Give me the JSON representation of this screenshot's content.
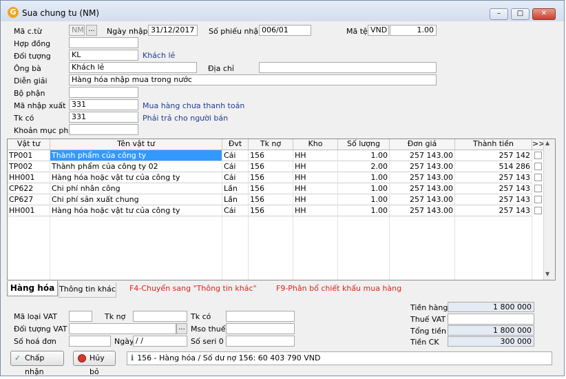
{
  "window": {
    "title": "Sua chung tu (NM)",
    "app_icon": "G",
    "controls": {
      "minimize": "–",
      "maximize": "□",
      "close": "✕"
    }
  },
  "header": {
    "ma_ct": {
      "label": "Mã c.từ",
      "value": "NM",
      "lookup": "..."
    },
    "ngay_nhap": {
      "label": "Ngày nhập",
      "value": "31/12/2017"
    },
    "so_phieu_nhap": {
      "label": "Số phiếu nhập",
      "value": "006/01"
    },
    "ma_te": {
      "label": "Mã tệ",
      "currency": "VND",
      "rate": "1.00"
    },
    "hop_dong": {
      "label": "Hợp đồng",
      "value": ""
    },
    "doi_tuong": {
      "label": "Đối tượng",
      "value": "KL",
      "name": "Khách lẻ"
    },
    "ong_ba": {
      "label": "Ông bà",
      "value": "Khách lẻ"
    },
    "dia_chi": {
      "label": "Địa chỉ",
      "value": ""
    },
    "dien_giai": {
      "label": "Diễn giải",
      "value": "Hàng hóa nhập mua trong nước"
    },
    "bo_phan": {
      "label": "Bộ phận",
      "value": ""
    },
    "ma_nhap_xuat": {
      "label": "Mã nhập xuất",
      "value": "331",
      "desc": "Mua hàng chưa thanh toán"
    },
    "tk_co": {
      "label": "Tk có",
      "value": "331",
      "desc": "Phải trả cho người bán"
    },
    "khoan_muc_phi": {
      "label": "Khoản mục phí",
      "value": ""
    }
  },
  "grid": {
    "columns": [
      "Vật tư",
      "Tên vật tư",
      "Đvt",
      "Tk nợ",
      "Kho",
      "Số lượng",
      "Đơn giá",
      "Thành tiền",
      ">>"
    ],
    "rows": [
      [
        "TP001",
        "Thành phẩm của công ty",
        "Cái",
        "156",
        "HH",
        "1.00",
        "257 143.00",
        "257 142"
      ],
      [
        "TP002",
        "Thành phẩm của công ty 02",
        "Cái",
        "156",
        "HH",
        "2.00",
        "257 143.00",
        "514 286"
      ],
      [
        "HH001",
        "Hàng hóa hoặc vật tư của công ty",
        "Cái",
        "156",
        "HH",
        "1.00",
        "257 143.00",
        "257 143"
      ],
      [
        "CP622",
        "Chi phí nhân công",
        "Lần",
        "156",
        "HH",
        "1.00",
        "257 143.00",
        "257 143"
      ],
      [
        "CP627",
        "Chi phí sản xuất chung",
        "Lần",
        "156",
        "HH",
        "1.00",
        "257 143.00",
        "257 143"
      ],
      [
        "HH001",
        "Hàng hóa hoặc vật tư của công ty",
        "Cái",
        "156",
        "HH",
        "1.00",
        "257 143.00",
        "257 143"
      ]
    ],
    "scroll_up": "▲",
    "scroll_down": "▼"
  },
  "tabs": {
    "hang_hoa": "Hàng hóa",
    "thong_tin_khac": "Thông tin khác",
    "hint_f4": "F4-Chuyển sang \"Thông tin khác\"",
    "hint_f9": "F9-Phân bổ chiết khấu mua hàng"
  },
  "vat": {
    "ma_loai_vat": {
      "label": "Mã loại VAT",
      "value": ""
    },
    "tk_no": {
      "label": "Tk nợ",
      "value": ""
    },
    "tk_co": {
      "label": "Tk có",
      "value": ""
    },
    "doi_tuong_vat": {
      "label": "Đối tượng VAT",
      "value": "",
      "lookup": "..."
    },
    "mso_thue": {
      "label": "Mso thuế",
      "value": ""
    },
    "so_hoa_don": {
      "label": "Số hoá đơn",
      "value": ""
    },
    "ngay": {
      "label": "Ngày",
      "value": " /  /"
    },
    "so_seri": {
      "label": "Số seri 0",
      "value": ""
    }
  },
  "totals": {
    "tien_hang": {
      "label": "Tiền hàng",
      "value": "1 800 000"
    },
    "thue_vat": {
      "label": "Thuế VAT",
      "value": ""
    },
    "tong_tien": {
      "label": "Tổng tiền",
      "value": "1 800 000"
    },
    "tien_ck": {
      "label": "Tiền CK",
      "value": "300 000"
    }
  },
  "buttons": {
    "accept": "Chấp nhận",
    "cancel": "Hủy bỏ"
  },
  "status_bar": "156 - Hàng hóa / Số dư nợ 156: 60 403 790 VND"
}
